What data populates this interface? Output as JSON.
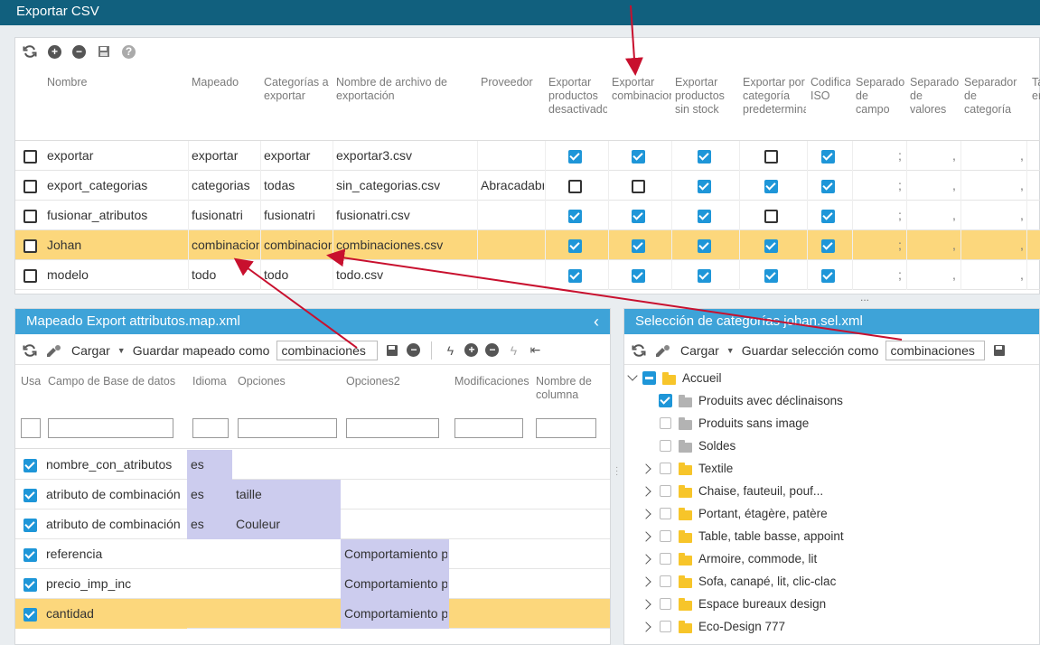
{
  "window": {
    "title": "Exportar CSV"
  },
  "export_table": {
    "columns": [
      "Nombre",
      "Mapeado",
      "Categorías a exportar",
      "Nombre de archivo de exportación",
      "Proveedor",
      "Exportar productos desactivados",
      "Exportar combinaciones",
      "Exportar productos sin stock",
      "Exportar por categoría predeterminada",
      "Codificación ISO",
      "Separador de campo",
      "Separador de valores",
      "Separador de categoría",
      "Ta en"
    ],
    "rows": [
      {
        "nombre": "exportar",
        "mapeado": "exportar",
        "categorias": "exportar",
        "archivo": "exportar3.csv",
        "proveedor": "",
        "checks": [
          true,
          true,
          true,
          false,
          true
        ],
        "sep_campo": ";",
        "sep_valores": ",",
        "sep_categoria": ",",
        "selected": false
      },
      {
        "nombre": "export_categorias",
        "mapeado": "categorias",
        "categorias": "todas",
        "archivo": "sin_categorias.csv",
        "proveedor": "Abracadabra",
        "checks": [
          false,
          false,
          true,
          true,
          true
        ],
        "sep_campo": ";",
        "sep_valores": ",",
        "sep_categoria": ",",
        "selected": false
      },
      {
        "nombre": "fusionar_atributos",
        "mapeado": "fusionatri",
        "categorias": "fusionatri",
        "archivo": "fusionatri.csv",
        "proveedor": "",
        "checks": [
          true,
          true,
          true,
          false,
          true
        ],
        "sep_campo": ";",
        "sep_valores": ",",
        "sep_categoria": ",",
        "selected": false
      },
      {
        "nombre": "Johan",
        "mapeado": "combinaciones",
        "categorias": "combinaciones",
        "archivo": "combinaciones.csv",
        "proveedor": "",
        "checks": [
          true,
          true,
          true,
          true,
          true
        ],
        "sep_campo": ";",
        "sep_valores": ",",
        "sep_categoria": ",",
        "selected": true
      },
      {
        "nombre": "modelo",
        "mapeado": "todo",
        "categorias": "todo",
        "archivo": "todo.csv",
        "proveedor": "",
        "checks": [
          true,
          true,
          true,
          true,
          true
        ],
        "sep_campo": ";",
        "sep_valores": ",",
        "sep_categoria": ",",
        "selected": false
      }
    ],
    "more": "..."
  },
  "mapping_panel": {
    "title": "Mapeado Export attributos.map.xml",
    "load_label": "Cargar",
    "save_as_label": "Guardar mapeado como",
    "save_as_value": "combinaciones",
    "columns": [
      "Usa",
      "Campo de Base de datos",
      "Idioma",
      "Opciones",
      "Opciones2",
      "Modificaciones",
      "Nombre de columna"
    ],
    "rows": [
      {
        "campo": "nombre_con_atributos",
        "idioma": "es",
        "opciones": "",
        "opciones2": "",
        "selected": false
      },
      {
        "campo": "atributo de combinación",
        "idioma": "es",
        "opciones": "taille",
        "opciones2": "",
        "selected": false
      },
      {
        "campo": "atributo de combinación",
        "idioma": "es",
        "opciones": "Couleur",
        "opciones2": "",
        "selected": false
      },
      {
        "campo": "referencia",
        "idioma": "",
        "opciones": "",
        "opciones2": "Comportamiento p",
        "selected": false
      },
      {
        "campo": "precio_imp_inc",
        "idioma": "",
        "opciones": "",
        "opciones2": "Comportamiento p",
        "selected": false
      },
      {
        "campo": "cantidad",
        "idioma": "",
        "opciones": "",
        "opciones2": "Comportamiento p",
        "selected": true
      }
    ]
  },
  "category_panel": {
    "title": "Selección de categorías johan.sel.xml",
    "load_label": "Cargar",
    "save_as_label": "Guardar selección como",
    "save_as_value": "combinaciones",
    "tree": [
      {
        "label": "Accueil",
        "level": 0,
        "expanded": true,
        "checked": "partial",
        "folder": "yellow"
      },
      {
        "label": "Produits avec déclinaisons",
        "level": 1,
        "checked": true,
        "folder": "grey"
      },
      {
        "label": "Produits sans image",
        "level": 1,
        "checked": false,
        "folder": "grey"
      },
      {
        "label": "Soldes",
        "level": 1,
        "checked": false,
        "folder": "grey"
      },
      {
        "label": "Textile",
        "level": 1,
        "collapsible": true,
        "checked": false,
        "folder": "yellow"
      },
      {
        "label": "Chaise, fauteuil, pouf...",
        "level": 1,
        "collapsible": true,
        "checked": false,
        "folder": "yellow"
      },
      {
        "label": "Portant, étagère, patère",
        "level": 1,
        "collapsible": true,
        "checked": false,
        "folder": "yellow"
      },
      {
        "label": "Table, table basse, appoint",
        "level": 1,
        "collapsible": true,
        "checked": false,
        "folder": "yellow"
      },
      {
        "label": "Armoire, commode, lit",
        "level": 1,
        "collapsible": true,
        "checked": false,
        "folder": "yellow"
      },
      {
        "label": "Sofa, canapé, lit, clic-clac",
        "level": 1,
        "collapsible": true,
        "checked": false,
        "folder": "yellow"
      },
      {
        "label": "Espace bureaux design",
        "level": 1,
        "collapsible": true,
        "checked": false,
        "folder": "yellow"
      },
      {
        "label": "Eco-Design 777",
        "level": 1,
        "collapsible": true,
        "checked": false,
        "folder": "yellow"
      }
    ]
  },
  "colors": {
    "topbar": "#11607e",
    "panel_header": "#3ea3d8",
    "selected_row": "#fcd77c",
    "accent": "#1e96d8",
    "annotation_arrow": "#c8102e"
  }
}
